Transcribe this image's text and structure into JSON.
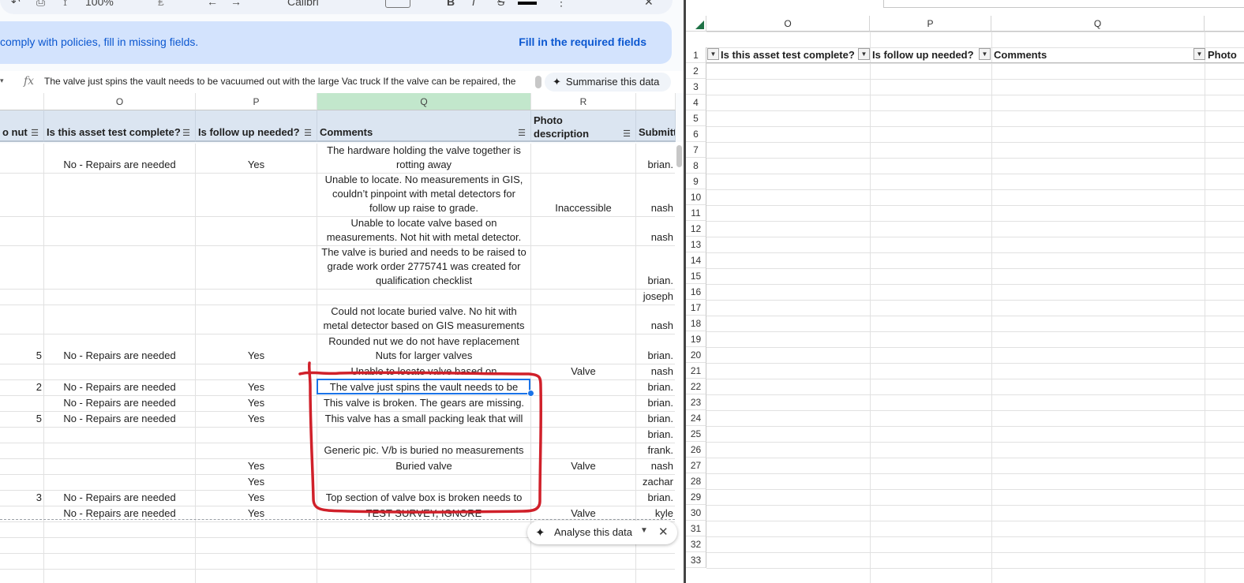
{
  "sheets": {
    "toolbar": {
      "zoom": "100%",
      "font": "Calibri",
      "items": [
        "↶",
        "⎙",
        "⟟",
        "⋮",
        "B",
        "I",
        "S",
        "A"
      ]
    },
    "banner": {
      "message": "comply with policies, fill in missing fields.",
      "action": "Fill in the required fields"
    },
    "formula_bar": {
      "fx": "fx",
      "text": "The valve just spins the vault needs to be vacuumed out with the large Vac truck If the valve can be repaired, the",
      "summarise_label": "Summarise this data"
    },
    "columns": {
      "N": "",
      "O": "O",
      "P": "P",
      "Q": "Q",
      "R": "R",
      "S": ""
    },
    "headers": {
      "n": "o nut",
      "o": "Is this asset test complete?",
      "p": "Is follow up needed?",
      "q": "Comments",
      "r": "Photo description",
      "s": "Submitt"
    },
    "rows": [
      {
        "n": "",
        "o": "No - Repairs are needed",
        "p": "Yes",
        "q": "The hardware holding the valve together is rotting away",
        "r": "",
        "s": "brian."
      },
      {
        "n": "",
        "o": "",
        "p": "",
        "q": "Unable to locate. No measurements in GIS, couldn’t pinpoint with metal detectors for follow up raise to grade.",
        "r": "Inaccessible",
        "s": "nash"
      },
      {
        "n": "",
        "o": "",
        "p": "",
        "q": "Unable to locate valve based on measurements. Not hit with metal detector.",
        "r": "",
        "s": "nash"
      },
      {
        "n": "",
        "o": "",
        "p": "",
        "q": "The valve is buried and needs to be raised to grade work order 2775741 was created for qualification checklist",
        "r": "",
        "s": "brian."
      },
      {
        "n": "",
        "o": "",
        "p": "",
        "q": "",
        "r": "",
        "s": "joseph"
      },
      {
        "n": "",
        "o": "",
        "p": "",
        "q": "Could not locate buried valve. No hit with metal detector based on GIS measurements",
        "r": "",
        "s": "nash"
      },
      {
        "n": "5",
        "o": "No - Repairs are needed",
        "p": "Yes",
        "q": "Rounded nut we do not have replacement Nuts for larger valves",
        "r": "",
        "s": "brian."
      },
      {
        "n": "",
        "o": "",
        "p": "",
        "q": "Unable to locate valve based on",
        "r": "Valve",
        "s": "nash"
      },
      {
        "n": "2",
        "o": "No - Repairs are needed",
        "p": "Yes",
        "q": "The valve just spins the vault needs to be",
        "r": "",
        "s": "brian."
      },
      {
        "n": "",
        "o": "No - Repairs are needed",
        "p": "Yes",
        "q": "This valve is broken. The gears are missing.",
        "r": "",
        "s": "brian."
      },
      {
        "n": "5",
        "o": "No - Repairs are needed",
        "p": "Yes",
        "q": "This valve has a small packing leak that will",
        "r": "",
        "s": "brian."
      },
      {
        "n": "",
        "o": "",
        "p": "",
        "q": "",
        "r": "",
        "s": "brian."
      },
      {
        "n": "",
        "o": "",
        "p": "",
        "q": "Generic pic.  V/b is buried no measurements",
        "r": "",
        "s": "frank."
      },
      {
        "n": "",
        "o": "",
        "p": "Yes",
        "q": "Buried valve",
        "r": "Valve",
        "s": "nash"
      },
      {
        "n": "",
        "o": "",
        "p": "Yes",
        "q": "",
        "r": "",
        "s": "zachar"
      },
      {
        "n": "3",
        "o": "No - Repairs are needed",
        "p": "Yes",
        "q": "Top section of valve box is broken needs to",
        "r": "",
        "s": "brian."
      },
      {
        "n": "",
        "o": "No - Repairs are needed",
        "p": "Yes",
        "q": "TEST SURVEY, IGNORE",
        "r": "Valve",
        "s": "kyle"
      }
    ],
    "analyse": {
      "label": "Analyse this data"
    }
  },
  "excel": {
    "columns": [
      "O",
      "P",
      "Q"
    ],
    "headers": [
      "Is this asset test complete?",
      "Is follow up needed?",
      "Comments",
      "Photo"
    ],
    "row_numbers": [
      1,
      2,
      3,
      4,
      5,
      6,
      7,
      8,
      9,
      10,
      11,
      12,
      13,
      14,
      15,
      16,
      17,
      18,
      19,
      20,
      21,
      22,
      23,
      24,
      25,
      26,
      27,
      28,
      29,
      30,
      31,
      32,
      33
    ],
    "dropdown_glyph": "▼"
  },
  "icons": {
    "filter": "filter-icon",
    "sparkle": "sparkle-icon",
    "close": "close-icon"
  },
  "colors": {
    "banner_bg": "#d3e3fd",
    "link_blue": "#0b57d0",
    "header_bg": "#dbe5f1",
    "annotation_red": "#d0202a",
    "selection_blue": "#1a73e8"
  }
}
